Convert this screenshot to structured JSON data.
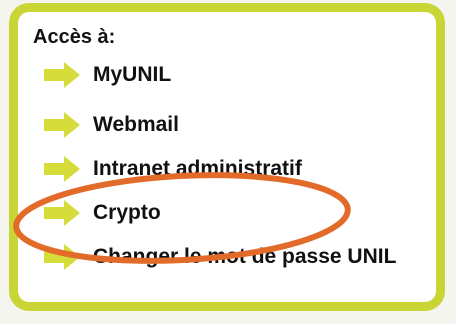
{
  "panel": {
    "title": "Accès à:",
    "links": [
      {
        "label": "MyUNIL"
      },
      {
        "label": "Webmail"
      },
      {
        "label": "Intranet administratif"
      },
      {
        "label": "Crypto"
      },
      {
        "label": "Changer le mot de passe UNIL"
      }
    ]
  },
  "colors": {
    "border": "#c9d535",
    "arrow": "#d6dd3a",
    "highlight_ellipse": "#e36b2a",
    "text": "#111111"
  },
  "icons": {
    "link_bullet": "arrow-right-icon"
  }
}
